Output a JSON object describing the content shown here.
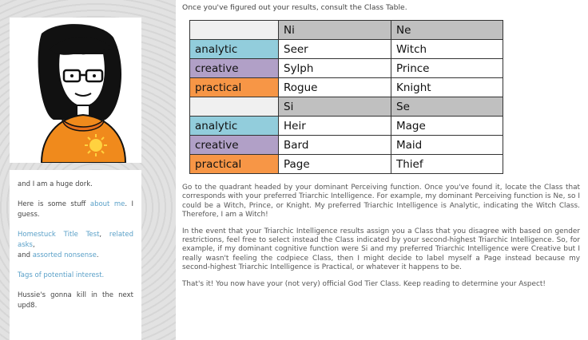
{
  "sidebar": {
    "line1": "and I am a huge dork.",
    "stuff_prefix": "Here is some stuff ",
    "about_me": "about me",
    "stuff_suffix": ". I guess.",
    "link_title_test": "Homestuck Title Test",
    "sep1": ", ",
    "link_related": "related asks",
    "sep2": ",",
    "and_text": "and ",
    "link_assorted": "assorted nonsense",
    "period": ".",
    "link_tags": "Tags of potential interest.",
    "line_last": "Hussie's gonna kill in the next upd8."
  },
  "main": {
    "intro": "Once you've figured out your results, consult the Class Table.",
    "table": {
      "rows": [
        [
          "",
          "Ni",
          "Ne"
        ],
        [
          "analytic",
          "Seer",
          "Witch"
        ],
        [
          "creative",
          "Sylph",
          "Prince"
        ],
        [
          "practical",
          "Rogue",
          "Knight"
        ],
        [
          "",
          "Si",
          "Se"
        ],
        [
          "analytic",
          "Heir",
          "Mage"
        ],
        [
          "creative",
          "Bard",
          "Maid"
        ],
        [
          "practical",
          "Page",
          "Thief"
        ]
      ]
    },
    "para1": "Go to the quadrant headed by your dominant Perceiving function. Once you've found it, locate the Class that corresponds with your preferred Triarchic Intelligence. For example, my dominant Perceiving function is Ne, so I could be a Witch, Prince, or Knight. My preferred Triarchic Intelligence is Analytic, indicating the Witch Class. Therefore, I am a Witch!",
    "para2": "In the event that your Triarchic Intelligence results assign you a Class that you disagree with based on gender restrictions, feel free to select instead the Class indicated by your second-highest Triarchic Intelligence. So, for example, if my dominant cognitive function were Si and my preferred Triarchic Intelligence were Creative but I really wasn't feeling the codpiece Class, then I might decide to label myself a Page instead because my second-highest Triarchic Intelligence is Practical, or whatever it happens to be.",
    "para3": "That's it! You now have your (not very) official God Tier Class. Keep reading to determine your Aspect!"
  },
  "colors": {
    "analytic": "#92cddc",
    "creative": "#b1a0c7",
    "practical": "#f79646",
    "header": "#c0c0c0",
    "link": "#5aa0c8"
  }
}
